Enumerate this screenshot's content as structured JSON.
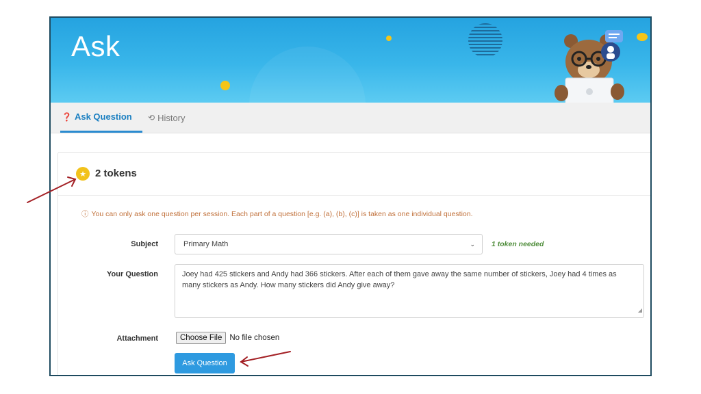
{
  "banner": {
    "title": "Ask"
  },
  "tabs": [
    {
      "label": "Ask Question",
      "icon": "question-circle-icon",
      "active": true
    },
    {
      "label": "History",
      "icon": "history-icon",
      "active": false
    }
  ],
  "tokens": {
    "text": "2 tokens",
    "icon": "star-coin-icon"
  },
  "notice": {
    "text": "You can only ask one question per session. Each part of a question [e.g. (a), (b), (c)] is taken as one individual question.",
    "icon": "info-icon"
  },
  "form": {
    "subject_label": "Subject",
    "subject_value": "Primary Math",
    "tokens_needed": "1 token needed",
    "question_label": "Your Question",
    "question_value": "Joey had 425 stickers and Andy had 366 stickers. After each of them gave away the same number of stickers, Joey had 4 times as many stickers as Andy. How many stickers did Andy give away?",
    "attachment_label": "Attachment",
    "choose_file_label": "Choose File",
    "no_file_text": "No file chosen",
    "submit_label": "Ask Question"
  },
  "colors": {
    "banner": "#2aa8e3",
    "accent": "#2e9ae0",
    "token": "#f2c21b",
    "notice": "#c0703a",
    "success": "#4f8d3b",
    "arrow": "#a31f24",
    "frame": "#1e4a5f"
  }
}
